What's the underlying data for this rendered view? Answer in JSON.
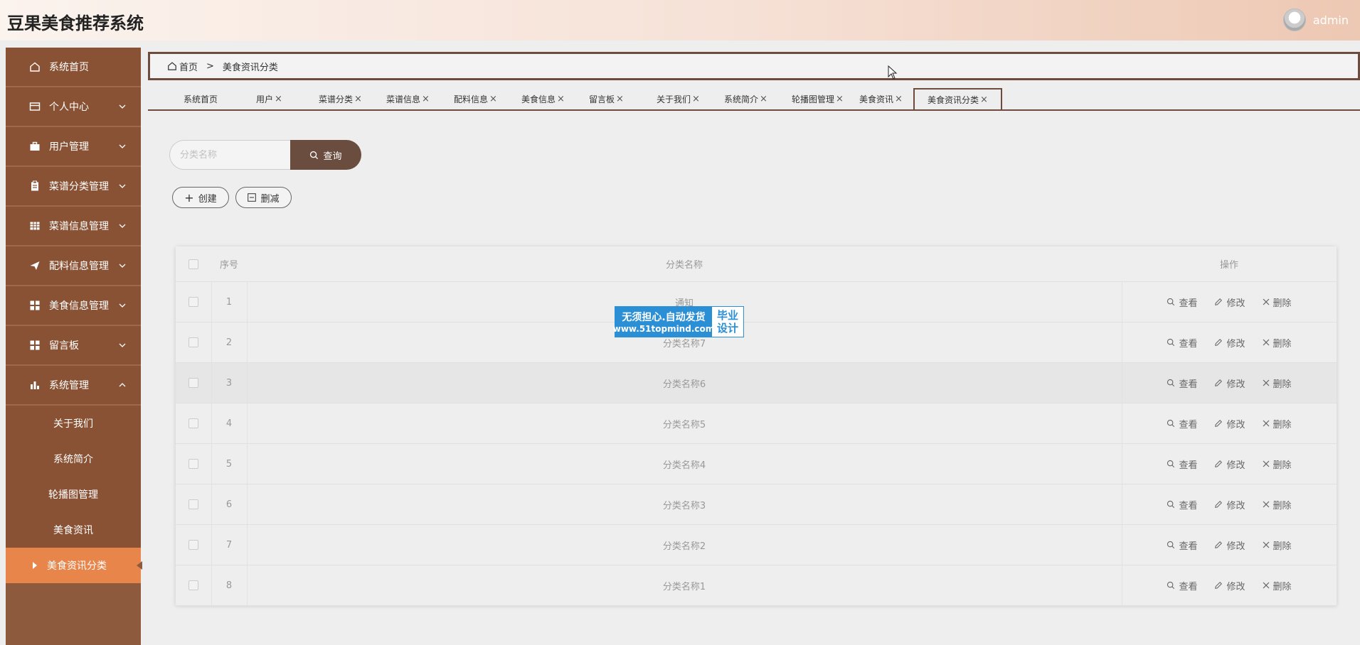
{
  "header": {
    "title": "豆果美食推荐系统",
    "username": "admin"
  },
  "sidebar": {
    "items": [
      {
        "label": "系统首页",
        "icon": "home-icon"
      },
      {
        "label": "个人中心",
        "icon": "wallet-icon"
      },
      {
        "label": "用户管理",
        "icon": "briefcase-icon"
      },
      {
        "label": "菜谱分类管理",
        "icon": "clipboard-icon"
      },
      {
        "label": "菜谱信息管理",
        "icon": "grid-icon"
      },
      {
        "label": "配料信息管理",
        "icon": "send-icon"
      },
      {
        "label": "美食信息管理",
        "icon": "apps-icon"
      },
      {
        "label": "留言板",
        "icon": "apps-icon"
      },
      {
        "label": "系统管理",
        "icon": "bar-chart-icon"
      }
    ],
    "sub_items": [
      "关于我们",
      "系统简介",
      "轮播图管理",
      "美食资讯",
      "美食资讯分类"
    ],
    "colors": {
      "bg": "#8a5234",
      "active": "#e8854a"
    }
  },
  "breadcrumb": {
    "home": "首页",
    "separator": ">",
    "current": "美食资讯分类"
  },
  "tabs": [
    {
      "label": "系统首页",
      "closable": false
    },
    {
      "label": "用户",
      "closable": true
    },
    {
      "label": "菜谱分类",
      "closable": true
    },
    {
      "label": "菜谱信息",
      "closable": true
    },
    {
      "label": "配料信息",
      "closable": true
    },
    {
      "label": "美食信息",
      "closable": true
    },
    {
      "label": "留言板",
      "closable": true
    },
    {
      "label": "关于我们",
      "closable": true
    },
    {
      "label": "系统简介",
      "closable": true
    },
    {
      "label": "轮播图管理",
      "closable": true
    },
    {
      "label": "美食资讯",
      "closable": true
    },
    {
      "label": "美食资讯分类",
      "closable": true
    }
  ],
  "search": {
    "placeholder": "分类名称",
    "button_label": "查询"
  },
  "actions": {
    "create_label": "创建",
    "delete_label": "删减"
  },
  "table": {
    "columns": [
      "序号",
      "分类名称",
      "操作"
    ],
    "rows": [
      {
        "index": "1",
        "name": "通知"
      },
      {
        "index": "2",
        "name": "分类名称7"
      },
      {
        "index": "3",
        "name": "分类名称6"
      },
      {
        "index": "4",
        "name": "分类名称5"
      },
      {
        "index": "5",
        "name": "分类名称4"
      },
      {
        "index": "6",
        "name": "分类名称3"
      },
      {
        "index": "7",
        "name": "分类名称2"
      },
      {
        "index": "8",
        "name": "分类名称1"
      }
    ],
    "row_actions": {
      "view": "查看",
      "edit": "修改",
      "remove": "删除"
    }
  },
  "watermark": {
    "line1": "无须担心.自动发货",
    "line2": "www.51topmind.com",
    "right1": "毕业",
    "right2": "设计"
  }
}
